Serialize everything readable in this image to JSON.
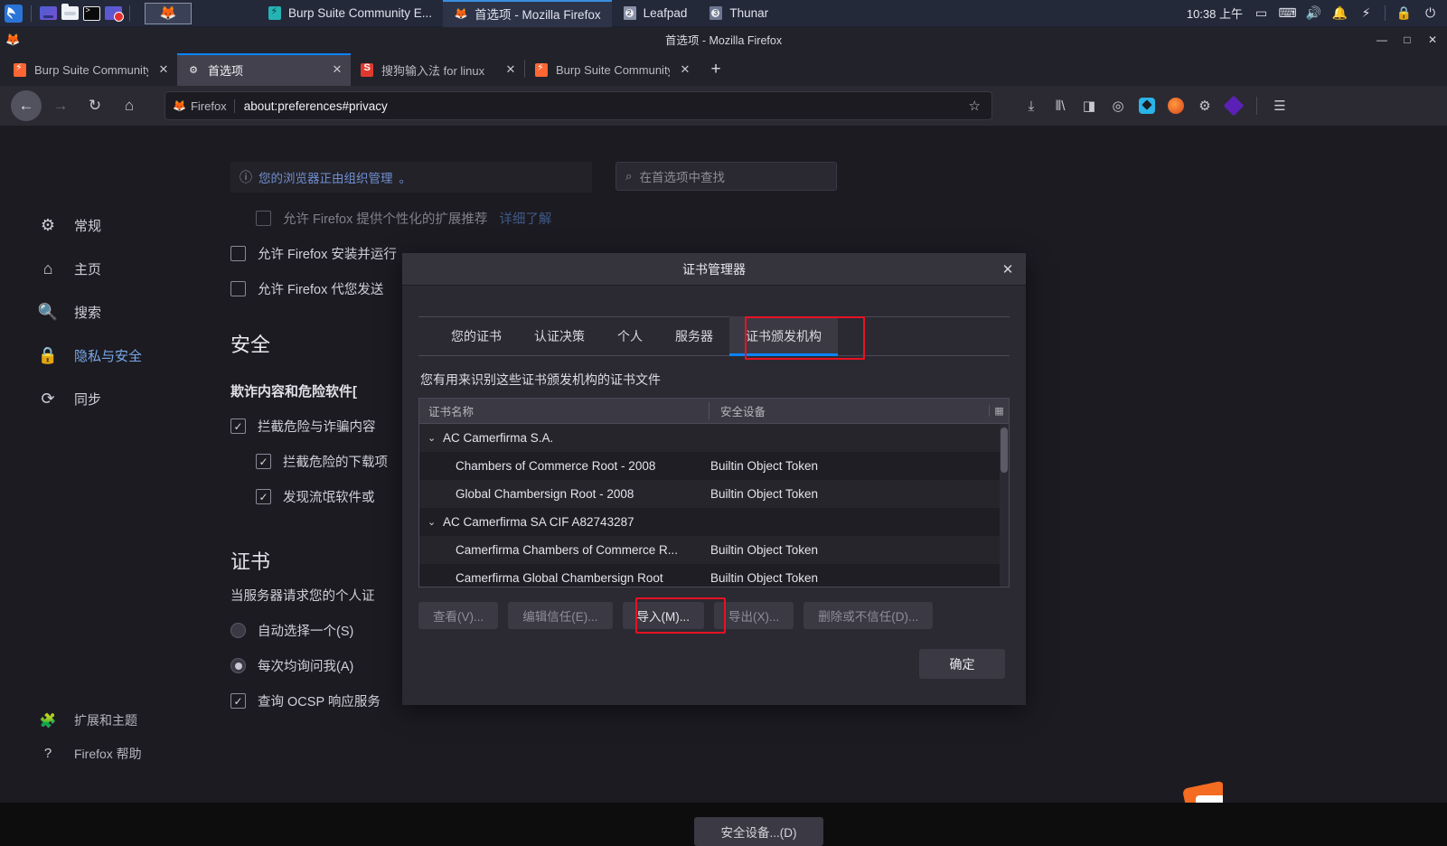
{
  "panel": {
    "launchers": [
      {
        "name": "kali-menu",
        "icon": "kali-dragon-icon"
      },
      {
        "name": "launcher-files",
        "icon": "files-icon"
      },
      {
        "name": "launcher-filemanager",
        "icon": "folder-icon"
      },
      {
        "name": "launcher-terminal",
        "icon": "terminal-icon"
      },
      {
        "name": "launcher-screenrecord",
        "icon": "screen-record-icon"
      },
      {
        "name": "launcher-firefox",
        "icon": "firefox-icon"
      }
    ],
    "tasks": [
      {
        "label": "Burp Suite Community E...",
        "icon": "burp-icon",
        "active": false
      },
      {
        "label": "首选项 - Mozilla Firefox",
        "icon": "firefox-icon",
        "active": true
      },
      {
        "label": "Leafpad",
        "icon": "leafpad-icon",
        "active": false
      },
      {
        "label": "Thunar",
        "icon": "thunar-icon",
        "active": false
      }
    ],
    "clock": "10:38 上午",
    "tray": [
      {
        "name": "display-icon",
        "glyph": "▭"
      },
      {
        "name": "keyboard-icon",
        "glyph": "⌨"
      },
      {
        "name": "volume-icon",
        "glyph": "🔊"
      },
      {
        "name": "notification-bell-icon",
        "glyph": "🔔"
      },
      {
        "name": "power-bolt-icon",
        "glyph": "⚡"
      },
      {
        "name": "lock-icon",
        "glyph": "🔒"
      },
      {
        "name": "logout-icon",
        "glyph": "⏻"
      }
    ]
  },
  "firefox": {
    "window_title": "首选项 - Mozilla Firefox",
    "window_controls": {
      "minimize": "—",
      "maximize": "□",
      "close": "✕"
    },
    "tabs": [
      {
        "label": "Burp Suite Community E",
        "favicon": "burp-icon",
        "active": false
      },
      {
        "label": "首选项",
        "favicon": "gear-icon",
        "active": true
      },
      {
        "label": "搜狗输入法 for linux",
        "favicon": "sogou-icon",
        "active": false
      },
      {
        "label": "Burp Suite Community E",
        "favicon": "burp-icon",
        "active": false
      }
    ],
    "new_tab_label": "+",
    "nav": {
      "back": "←",
      "forward": "→",
      "reload": "↻",
      "home": "⌂",
      "identity_label": "Firefox",
      "url": "about:preferences#privacy",
      "bookmark_star": "☆"
    },
    "toolbar_icons": [
      {
        "name": "downloads-icon",
        "glyph": "⤓"
      },
      {
        "name": "library-icon",
        "glyph": "‖\\"
      },
      {
        "name": "sidebar-icon",
        "glyph": "◧"
      },
      {
        "name": "account-icon",
        "glyph": "ⓘ"
      },
      {
        "name": "extension-sync-icon",
        "glyph": ""
      },
      {
        "name": "extension-orange-icon",
        "glyph": ""
      },
      {
        "name": "extension-gear-icon",
        "glyph": "⚙"
      },
      {
        "name": "extension-purple-icon",
        "glyph": ""
      },
      {
        "name": "app-menu-icon",
        "glyph": "☰"
      }
    ]
  },
  "preferences": {
    "sidebar": [
      {
        "label": "常规",
        "icon": "gear-icon",
        "active": false
      },
      {
        "label": "主页",
        "icon": "home-icon",
        "active": false
      },
      {
        "label": "搜索",
        "icon": "search-icon",
        "active": false
      },
      {
        "label": "隐私与安全",
        "icon": "lock-icon",
        "active": true
      },
      {
        "label": "同步",
        "icon": "sync-icon",
        "active": false
      }
    ],
    "sidebar_bottom": [
      {
        "label": "扩展和主题",
        "icon": "puzzle-icon"
      },
      {
        "label": "Firefox 帮助",
        "icon": "question-circle-icon"
      }
    ],
    "org_banner": {
      "icon": "info-icon",
      "text": "您的浏览器正由组织管理",
      "suffix": "。"
    },
    "search_placeholder": "在首选项中查找",
    "search_icon": "search-icon",
    "checkboxes": [
      {
        "label": "允许 Firefox 提供个性化的扩展推荐",
        "link": "详细了解",
        "checked": false,
        "disabled": true,
        "indent": 1
      },
      {
        "label": "允许 Firefox 安装并运行",
        "checked": false,
        "disabled": false,
        "indent": 0
      },
      {
        "label": "允许 Firefox 代您发送",
        "checked": false,
        "disabled": false,
        "indent": 0
      }
    ],
    "security_heading": "安全",
    "deceptive_heading": "欺诈内容和危险软件[",
    "deceptive_items": [
      {
        "label": "拦截危险与诈骗内容",
        "checked": true,
        "indent": 0
      },
      {
        "label": "拦截危险的下载项",
        "checked": true,
        "indent": 1
      },
      {
        "label": "发现流氓软件或",
        "checked": true,
        "indent": 1
      }
    ],
    "cert_heading": "证书",
    "cert_para": "当服务器请求您的个人证",
    "cert_radios": [
      {
        "label": "自动选择一个(S)",
        "selected": false
      },
      {
        "label": "每次均询问我(A)",
        "selected": true
      }
    ],
    "ocsp_label": "查询 OCSP 响应服务",
    "ocsp_checked": true,
    "security_devices_button": "安全设备...(D)"
  },
  "cert_dialog": {
    "title": "证书管理器",
    "close_glyph": "✕",
    "tabs": [
      {
        "label": "您的证书",
        "active": false
      },
      {
        "label": "认证决策",
        "active": false
      },
      {
        "label": "个人",
        "active": false
      },
      {
        "label": "服务器",
        "active": false
      },
      {
        "label": "证书颁发机构",
        "active": true,
        "highlighted": true
      }
    ],
    "description": "您有用来识别这些证书颁发机构的证书文件",
    "table": {
      "columns": [
        "证书名称",
        "安全设备"
      ],
      "column_icon": "column-picker-icon",
      "rows": [
        {
          "type": "group",
          "name": "AC Camerfirma S.A.",
          "device": "",
          "expanded": true,
          "chevron": "⌄"
        },
        {
          "type": "cert",
          "name": "Chambers of Commerce Root - 2008",
          "device": "Builtin Object Token"
        },
        {
          "type": "cert",
          "name": "Global Chambersign Root - 2008",
          "device": "Builtin Object Token"
        },
        {
          "type": "group",
          "name": "AC Camerfirma SA CIF A82743287",
          "device": "",
          "expanded": true,
          "chevron": "⌄"
        },
        {
          "type": "cert",
          "name": "Camerfirma Chambers of Commerce R...",
          "device": "Builtin Object Token"
        },
        {
          "type": "cert",
          "name": "Camerfirma Global Chambersign Root",
          "device": "Builtin Object Token"
        }
      ]
    },
    "buttons": [
      {
        "label": "查看(V)...",
        "enabled": false,
        "highlighted": false
      },
      {
        "label": "编辑信任(E)...",
        "enabled": false,
        "highlighted": false
      },
      {
        "label": "导入(M)...",
        "enabled": true,
        "highlighted": true
      },
      {
        "label": "导出(X)...",
        "enabled": false,
        "highlighted": false
      },
      {
        "label": "删除或不信任(D)...",
        "enabled": false,
        "highlighted": false
      }
    ],
    "ok_button": "确定"
  },
  "colors": {
    "panel_bg": "#24293a",
    "firefox_chrome": "#2b2a33",
    "content_bg": "#1c1b22",
    "accent_blue": "#0a84ff",
    "highlight_red": "#e81123",
    "dialog_bg": "#2b2a33"
  }
}
